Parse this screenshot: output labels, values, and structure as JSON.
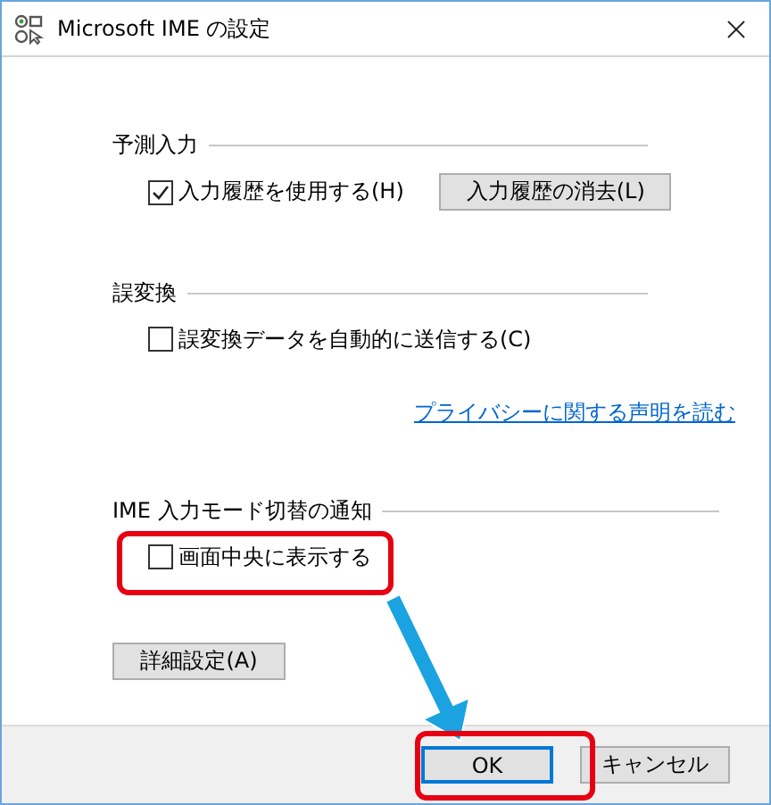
{
  "window": {
    "title": "Microsoft IME の設定"
  },
  "groups": [
    {
      "title": "予測入力",
      "items": [
        {
          "kind": "checkbox",
          "label": "入力履歴を使用する(H)",
          "checked": true
        },
        {
          "kind": "button",
          "label": "入力履歴の消去(L)"
        }
      ]
    },
    {
      "title": "誤変換",
      "items": [
        {
          "kind": "checkbox",
          "label": "誤変換データを自動的に送信する(C)",
          "checked": false
        },
        {
          "kind": "link",
          "label": "プライバシーに関する声明を読む"
        }
      ]
    },
    {
      "title": "IME 入力モード切替の通知",
      "items": [
        {
          "kind": "checkbox",
          "label": "画面中央に表示する",
          "checked": false
        }
      ]
    }
  ],
  "advanced_button": "詳細設定(A)",
  "footer_buttons": [
    {
      "label": "OK",
      "default": true
    },
    {
      "label": "キャンセル",
      "default": false
    }
  ]
}
